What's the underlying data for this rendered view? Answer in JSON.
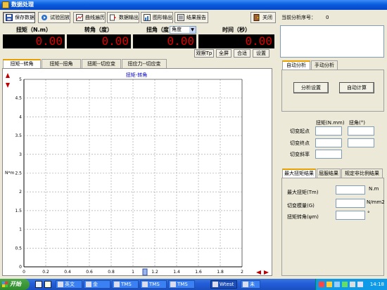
{
  "window": {
    "title": "数据处理"
  },
  "toolbar": {
    "save": "保存数据",
    "replay": "试验回放",
    "curve": "曲线遍历",
    "export_data": "数据输出",
    "export_graph": "图形输出",
    "report": "结果报告",
    "close": "关闭"
  },
  "current_no": {
    "label": "当前分析序号：",
    "value": "0"
  },
  "readouts": {
    "torque": {
      "label": "扭矩（N.m）",
      "value": "0.00"
    },
    "angle": {
      "label": "转角（度）",
      "value": "0.00"
    },
    "twist": {
      "label": "扭角（度",
      "select": "角度",
      "value": "0.00"
    },
    "time": {
      "label": "时间（秒）",
      "value": "0.00"
    }
  },
  "view_buttons": {
    "observe": "观察Tp",
    "fullscreen": "全屏",
    "fit": "合适",
    "settings": "设置"
  },
  "chart_tabs": [
    "扭矩--转角",
    "扭矩--扭角",
    "扭距--切应变",
    "扭应力--切应变"
  ],
  "chart_data": {
    "type": "line",
    "title": "扭矩-转角",
    "ylabel": "N*m",
    "xlim": [
      0,
      2
    ],
    "ylim": [
      0,
      5
    ],
    "x_ticks": [
      "0",
      "0.2",
      "0.4",
      "0.6",
      "0.8",
      "1",
      "1.2",
      "1.4",
      "1.6",
      "1.8",
      "2"
    ],
    "y_ticks": [
      "0",
      "0.5",
      "1",
      "1.5",
      "2",
      "2.5",
      "3",
      "3.5",
      "4",
      "4.5",
      "5"
    ],
    "grid": true,
    "series": []
  },
  "analysis_tabs": {
    "auto": "自动分析",
    "manual": "手动分析"
  },
  "analysis_buttons": {
    "settings": "分析设置",
    "auto_calc": "自动计算"
  },
  "analysis_table": {
    "col_torque": "扭矩(N.mm)",
    "col_angle": "扭角(°)",
    "row_start": "切变起点",
    "row_end": "切变终点",
    "row_slope": "切变斜率"
  },
  "result_tabs": [
    "最大扭矩结果",
    "屈服结果",
    "规定非比例结果"
  ],
  "results": {
    "max_torque": {
      "label": "最大扭矩(Tm)",
      "unit": "N.m",
      "value": ""
    },
    "shear_modulus": {
      "label": "切变模量(G)",
      "unit": "N/mm2",
      "value": ""
    },
    "torsion_angle": {
      "label": "扭矩转角(ψm)",
      "unit": "°",
      "value": ""
    }
  },
  "taskbar": {
    "start": "开始",
    "tasks": [
      "英文",
      "金",
      "TMS",
      "TMS",
      "TMS",
      "Wtest",
      "未"
    ],
    "clock": "14:18"
  },
  "colors": {
    "display_bg": "#000000",
    "display_fg": "#e00000",
    "chart_title": "#0000cc",
    "titlebar": "#0a5ddf"
  }
}
